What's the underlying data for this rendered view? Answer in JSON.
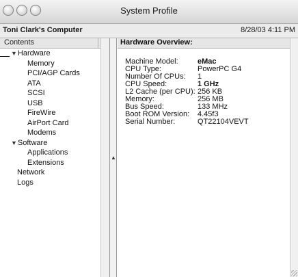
{
  "window": {
    "title": "System Profile"
  },
  "info_bar": {
    "computer_name": "Toni Clark's Computer",
    "datetime": "8/28/03 4:11 PM"
  },
  "contents": {
    "header": "Contents",
    "items": [
      {
        "label": "Hardware",
        "level": 0,
        "expanded": true
      },
      {
        "label": "Memory",
        "level": 1
      },
      {
        "label": "PCI/AGP Cards",
        "level": 1
      },
      {
        "label": "ATA",
        "level": 1
      },
      {
        "label": "SCSI",
        "level": 1
      },
      {
        "label": "USB",
        "level": 1
      },
      {
        "label": "FireWire",
        "level": 1
      },
      {
        "label": "AirPort Card",
        "level": 1
      },
      {
        "label": "Modems",
        "level": 1
      },
      {
        "label": "Software",
        "level": 0,
        "expanded": true
      },
      {
        "label": "Applications",
        "level": 1
      },
      {
        "label": "Extensions",
        "level": 1
      },
      {
        "label": "Network",
        "level": 0
      },
      {
        "label": "Logs",
        "level": 0
      }
    ],
    "expand_glyph": "▼"
  },
  "overview": {
    "header": "Hardware Overview:",
    "rows": [
      {
        "label": "Machine Model:",
        "value": "eMac",
        "bold": true
      },
      {
        "label": "CPU Type:",
        "value": "PowerPC G4",
        "bold": false
      },
      {
        "label": "Number Of CPUs:",
        "value": "1",
        "bold": false
      },
      {
        "label": "CPU Speed:",
        "value": "1 GHz",
        "bold": true
      },
      {
        "label": "L2 Cache (per CPU):",
        "value": "256 KB",
        "bold": false
      },
      {
        "label": "Memory:",
        "value": "256 MB",
        "bold": false
      },
      {
        "label": "Bus Speed:",
        "value": "133 MHz",
        "bold": false
      },
      {
        "label": "Boot ROM Version:",
        "value": "4.45f3",
        "bold": false
      },
      {
        "label": "Serial Number:",
        "value": "QT22104VEVT",
        "bold": false
      }
    ]
  },
  "splitter": {
    "arrow_glyph": "▲"
  }
}
